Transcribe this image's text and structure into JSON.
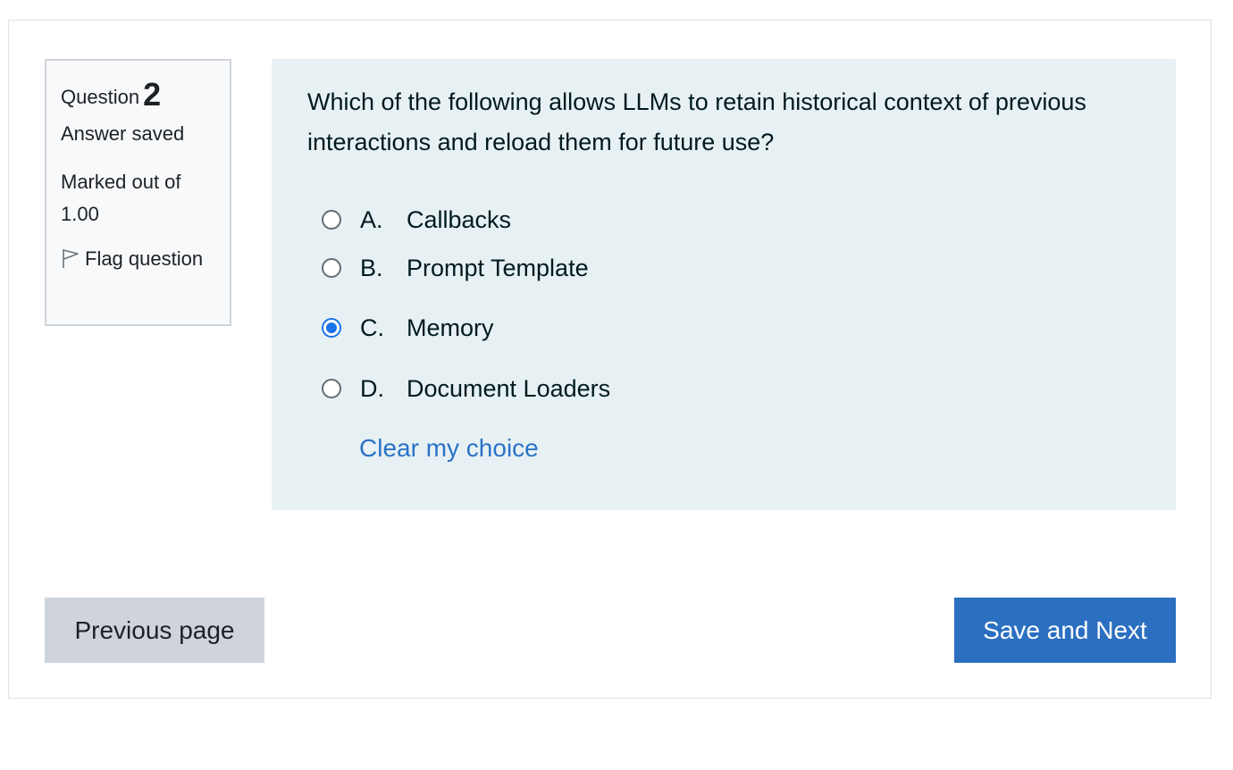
{
  "question_info": {
    "label": "Question",
    "number": "2",
    "state": "Answer saved",
    "grade": "Marked out of 1.00",
    "flag_label": "Flag question",
    "flag_icon": "flag-icon"
  },
  "question": {
    "text": "Which of the following allows LLMs to retain historical context of previous interactions and reload them for future use?",
    "options": [
      {
        "letter": "A.",
        "text": "Callbacks",
        "selected": false
      },
      {
        "letter": "B.",
        "text": "Prompt Template",
        "selected": false
      },
      {
        "letter": "C.",
        "text": "Memory",
        "selected": true
      },
      {
        "letter": "D.",
        "text": "Document Loaders",
        "selected": false
      }
    ],
    "clear_label": "Clear my choice"
  },
  "navigation": {
    "previous_label": "Previous page",
    "next_label": "Save and Next"
  },
  "colors": {
    "accent": "#1a73e8",
    "link": "#2a72c7",
    "primary_button": "#2b6fc0",
    "secondary_button": "#ced4da",
    "question_background": "#e7f1f3",
    "info_background": "#f8f9fa"
  }
}
